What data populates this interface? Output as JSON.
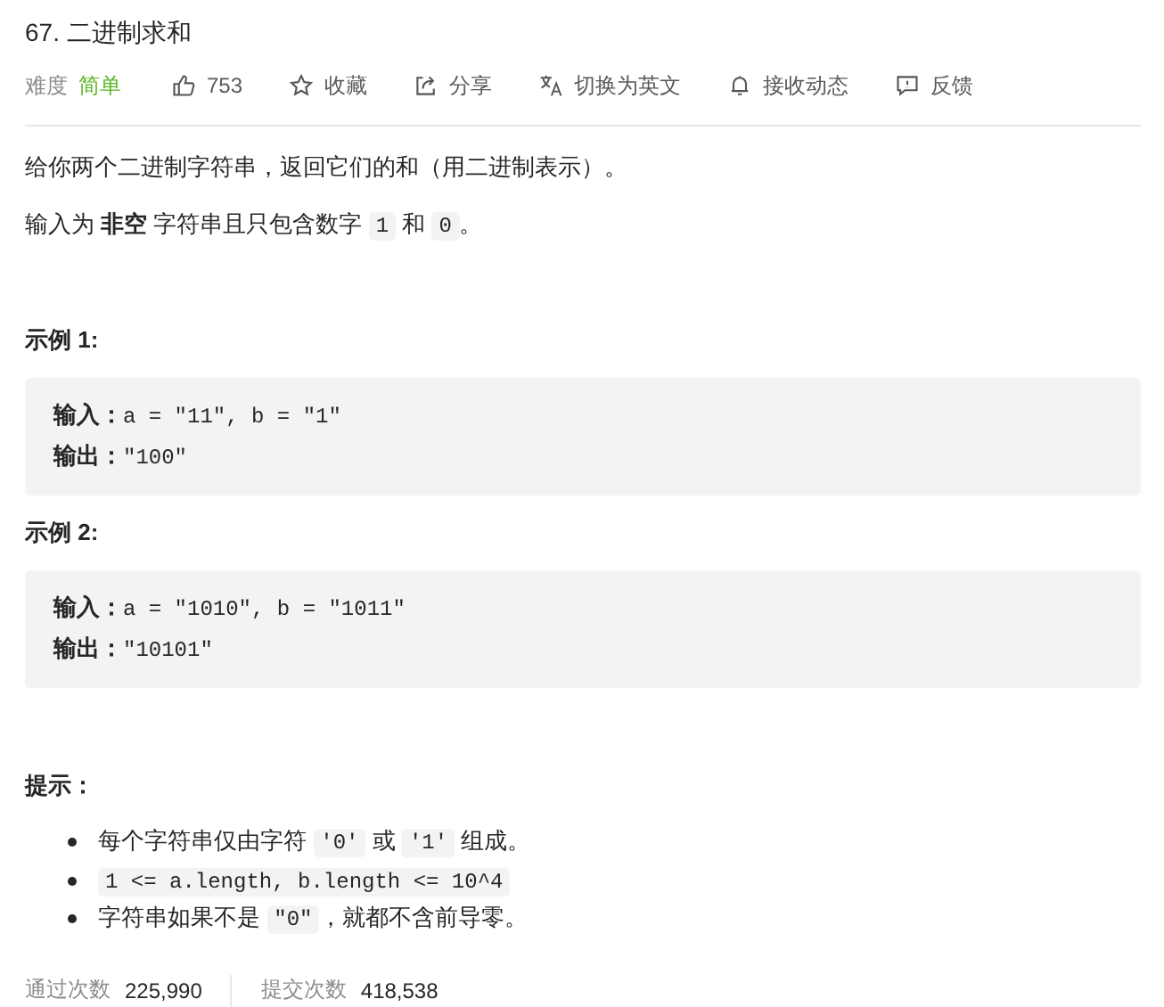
{
  "title": "67. 二进制求和",
  "meta": {
    "difficulty_label": "难度",
    "difficulty": "简单",
    "actions": [
      {
        "kind": "like",
        "label": "753"
      },
      {
        "kind": "star",
        "label": "收藏"
      },
      {
        "kind": "share",
        "label": "分享"
      },
      {
        "kind": "translate",
        "label": "切换为英文"
      },
      {
        "kind": "bell",
        "label": "接收动态"
      },
      {
        "kind": "feedback",
        "label": "反馈"
      }
    ]
  },
  "description": [
    [
      {
        "kind": "text",
        "text": "给你两个二进制字符串，返回它们的和（用二进制表示）。"
      }
    ],
    [
      {
        "kind": "text",
        "text": "输入为 "
      },
      {
        "kind": "bold",
        "text": "非空"
      },
      {
        "kind": "text",
        "text": " 字符串且只包含数字 "
      },
      {
        "kind": "code",
        "text": "1"
      },
      {
        "kind": "text",
        "text": " 和 "
      },
      {
        "kind": "code",
        "text": "0"
      },
      {
        "kind": "text",
        "text": "。"
      }
    ]
  ],
  "examples": [
    {
      "heading": "示例 1:",
      "lines": [
        {
          "label": "输入：",
          "value": "a = \"11\", b = \"1\""
        },
        {
          "label": "输出：",
          "value": "\"100\""
        }
      ]
    },
    {
      "heading": "示例 2:",
      "lines": [
        {
          "label": "输入：",
          "value": "a = \"1010\", b = \"1011\""
        },
        {
          "label": "输出：",
          "value": "\"10101\""
        }
      ]
    }
  ],
  "hints": {
    "heading": "提示：",
    "items": [
      [
        {
          "kind": "text",
          "text": "每个字符串仅由字符 "
        },
        {
          "kind": "code",
          "text": "'0'"
        },
        {
          "kind": "text",
          "text": " 或 "
        },
        {
          "kind": "code",
          "text": "'1'"
        },
        {
          "kind": "text",
          "text": " 组成。"
        }
      ],
      [
        {
          "kind": "code",
          "text": "1 <= a.length, b.length <= 10^4"
        }
      ],
      [
        {
          "kind": "text",
          "text": "字符串如果不是 "
        },
        {
          "kind": "code",
          "text": "\"0\""
        },
        {
          "kind": "text",
          "text": "，就都不含前导零。"
        }
      ]
    ]
  },
  "stats": [
    {
      "label": "通过次数",
      "value": "225,990"
    },
    {
      "label": "提交次数",
      "value": "418,538"
    }
  ]
}
